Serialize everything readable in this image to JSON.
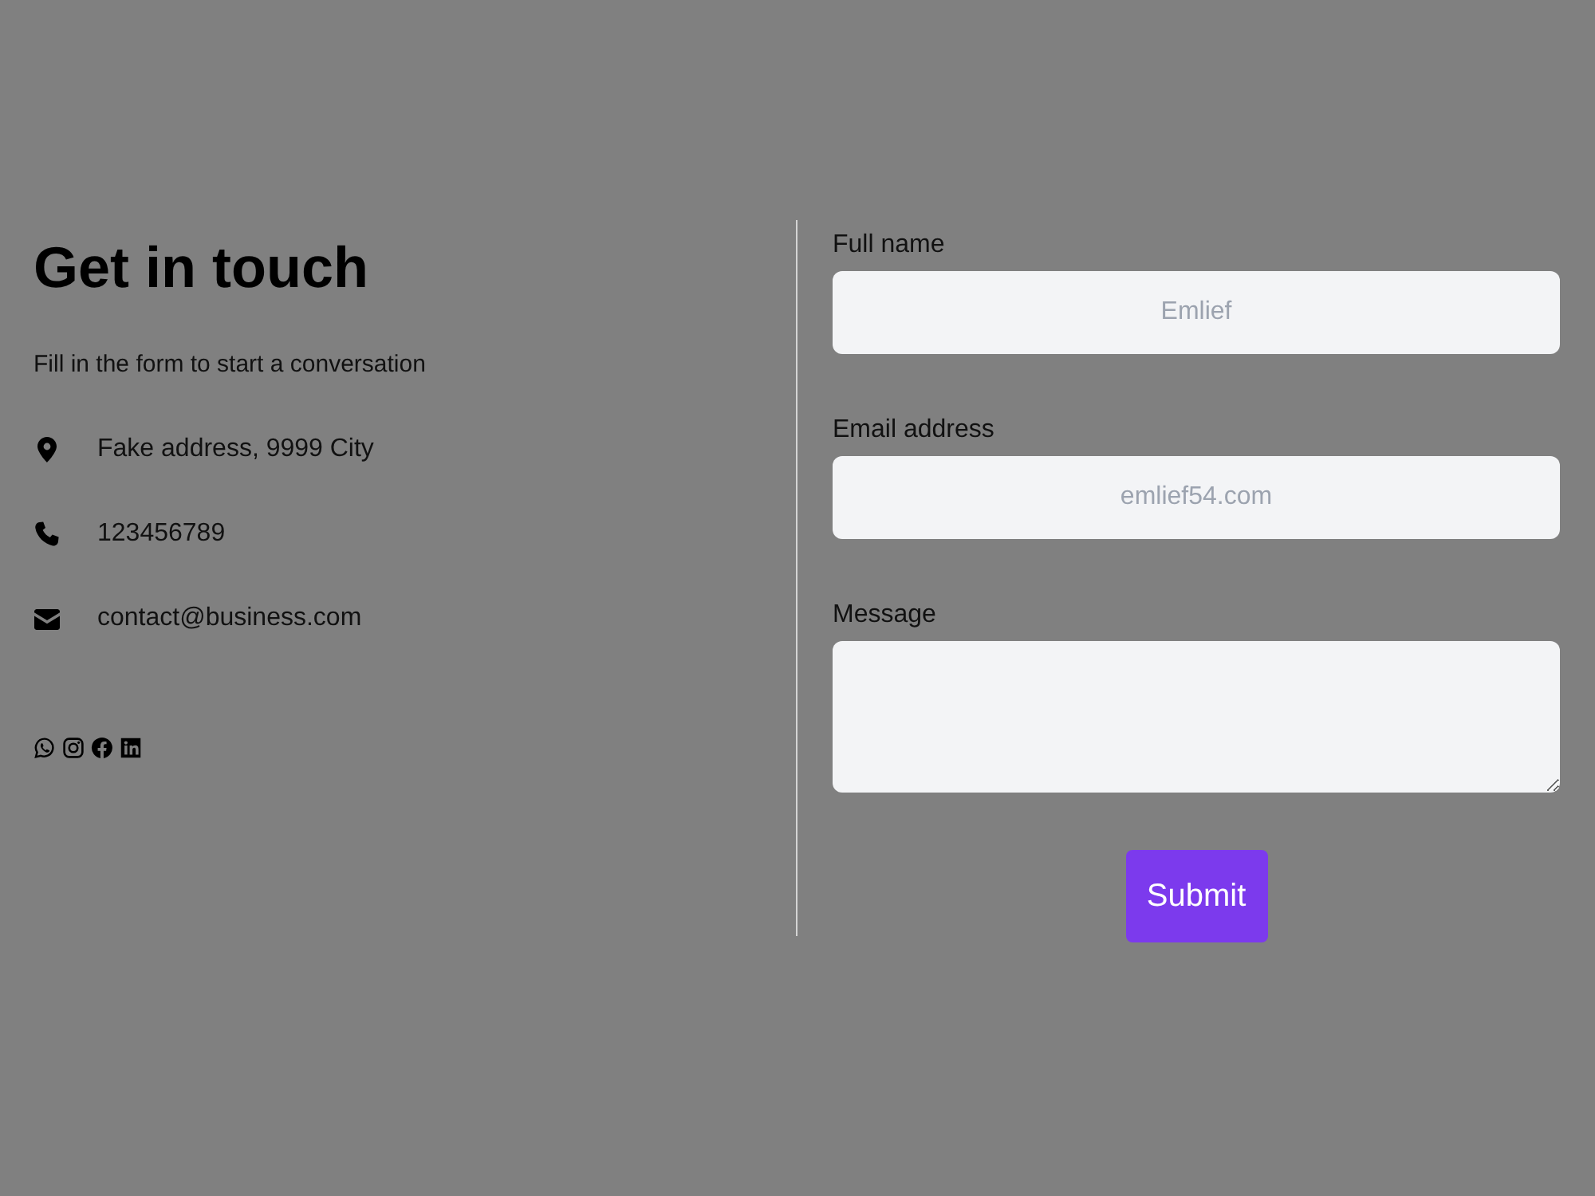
{
  "intro": {
    "title": "Get in touch",
    "subtitle": "Fill in the form to start a conversation"
  },
  "contacts": [
    {
      "kind": "address",
      "text": "Fake address, 9999 City"
    },
    {
      "kind": "phone",
      "text": "123456789"
    },
    {
      "kind": "email",
      "text": "contact@business.com"
    }
  ],
  "form": {
    "fields": [
      {
        "kind": "input",
        "label": "Full name",
        "placeholder": "Emlief"
      },
      {
        "kind": "input",
        "label": "Email address",
        "placeholder": "emlief54.com"
      },
      {
        "kind": "textarea",
        "label": "Message"
      }
    ],
    "submit": "Submit"
  }
}
